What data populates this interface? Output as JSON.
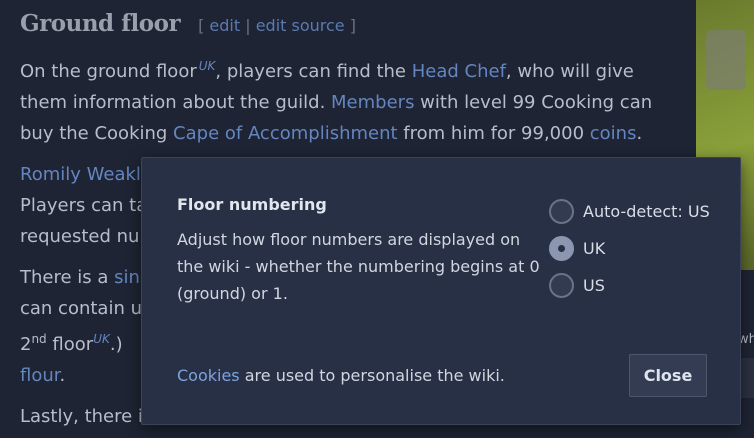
{
  "article": {
    "heading": "Ground floor",
    "edit": "edit",
    "edit_source": "edit source",
    "p1": {
      "t1": "On the ground floor",
      "uk": "UK",
      "t2": ", players can find the ",
      "head_chef": "Head Chef",
      "t3": ", who will give them information about the guild. ",
      "members": "Members",
      "t4": " with level 99 Cooking can buy the Cooking ",
      "cape": "Cape of Accomplishment",
      "t5": " from him for 99,000 ",
      "coins": "coins",
      "t6": "."
    },
    "p2": {
      "romily": "Romily Weakl",
      "line2": "Players can ta",
      "line3": "requested nur"
    },
    "p3": {
      "t1": "There is a ",
      "sink": "sink",
      "line2": "can contain up",
      "second": "2",
      "nd": "nd",
      "floor": " floor",
      "uk": "UK",
      "close": ".)",
      "flour": "flour",
      "dot": "."
    },
    "p4": "Lastly, there is",
    "side_text": "wh"
  },
  "modal": {
    "title": "Floor numbering",
    "description": "Adjust how floor numbers are displayed on the wiki - whether the numbering begins at 0 (ground) or 1.",
    "options": [
      {
        "label": "Auto-detect: US",
        "checked": false
      },
      {
        "label": "UK",
        "checked": true
      },
      {
        "label": "US",
        "checked": false
      }
    ],
    "footer_link": "Cookies",
    "footer_text": " are used to personalise the wiki.",
    "close_label": "Close"
  }
}
